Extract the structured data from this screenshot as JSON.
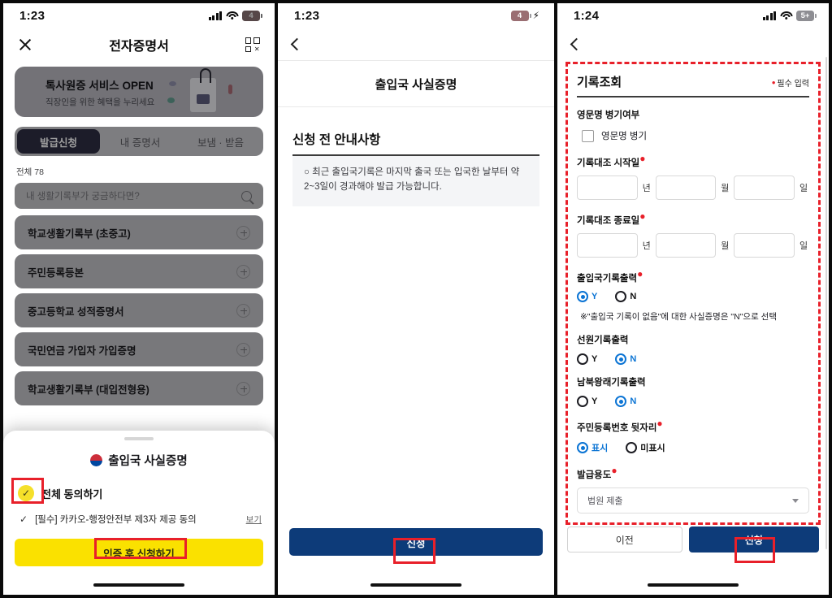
{
  "panel1": {
    "status": {
      "time": "1:23",
      "battery": "4",
      "signal_icon": "cellular-bars-icon",
      "wifi_icon": "wifi-icon"
    },
    "header": {
      "close_icon": "close-icon",
      "title": "전자증명서",
      "qr_icon": "qr-code-icon"
    },
    "banner": {
      "title": "톡사원증 서비스 OPEN",
      "subtitle": "직장인을 위한 혜택을 누리세요"
    },
    "tabs": [
      {
        "label": "발급신청",
        "active": true
      },
      {
        "label": "내 증명서",
        "active": false
      },
      {
        "label": "보냄 · 받음",
        "active": false
      }
    ],
    "count_label": "전체 78",
    "search": {
      "placeholder": "내 생활기록부가 궁금하다면?",
      "icon": "search-icon"
    },
    "documents": [
      {
        "label": "학교생활기록부 (초중고)"
      },
      {
        "label": "주민등록등본"
      },
      {
        "label": "중고등학교 성적증명서"
      },
      {
        "label": "국민연금 가입자 가입증명"
      },
      {
        "label": "학교생활기록부 (대입전형용)"
      }
    ],
    "sheet": {
      "flag_icon": "korea-flag-icon",
      "title": "출입국 사실증명",
      "agree_all": "전체 동의하기",
      "agree_item": "[필수] 카카오-행정안전부 제3자 제공 동의",
      "agree_item_more": "보기",
      "submit_label": "인증 후 신청하기"
    }
  },
  "panel2": {
    "status": {
      "time": "1:23",
      "battery": "4",
      "charging_icon": "bolt-icon"
    },
    "back_icon": "back-chevron-icon",
    "title": "출입국 사실증명",
    "section_heading": "신청 전 안내사항",
    "info_text": "○ 최근 출입국기록은 마지막 출국 또는 입국한 날부터 약2~3일이 경과해야 발급 가능합니다.",
    "submit_label": "신청"
  },
  "panel3": {
    "status": {
      "time": "1:24",
      "battery": "5+",
      "signal_icon": "cellular-bars-icon",
      "wifi_icon": "wifi-icon"
    },
    "back_icon": "back-chevron-icon",
    "form_title": "기록조회",
    "required_note": "필수 입력",
    "eng_name_label": "영문명 병기여부",
    "eng_name_checkbox": "영문명 병기",
    "start_date": {
      "label": "기록대조 시작일",
      "required": true,
      "year": "",
      "month": "",
      "day": "",
      "unit_year": "년",
      "unit_month": "월",
      "unit_day": "일"
    },
    "end_date": {
      "label": "기록대조 종료일",
      "required": true,
      "year": "",
      "month": "",
      "day": "",
      "unit_year": "년",
      "unit_month": "월",
      "unit_day": "일"
    },
    "immigration": {
      "label": "출입국기록출력",
      "required": true,
      "yes": "Y",
      "no": "N",
      "selected": "Y"
    },
    "immigration_note": "※\"출입국 기록이 없음\"에 대한 사실증명은 \"N\"으로 선택",
    "seafarer": {
      "label": "선원기록출력",
      "required": false,
      "yes": "Y",
      "no": "N",
      "selected": "N"
    },
    "inter_korean": {
      "label": "남북왕래기록출력",
      "required": false,
      "yes": "Y",
      "no": "N",
      "selected": "N"
    },
    "resident_number": {
      "label": "주민등록번호 뒷자리",
      "required": true,
      "show": "표시",
      "hide": "미표시",
      "selected": "표시"
    },
    "purpose": {
      "label": "발급용도",
      "required": true,
      "value": "법원 제출"
    },
    "prev_label": "이전",
    "submit_label": "신청"
  },
  "colors": {
    "highlight": "#e8202a",
    "primary_blue": "#0d3b79",
    "kakao_yellow": "#fae100",
    "radio_blue": "#0b74d4",
    "tab_active": "#2c2c52"
  }
}
